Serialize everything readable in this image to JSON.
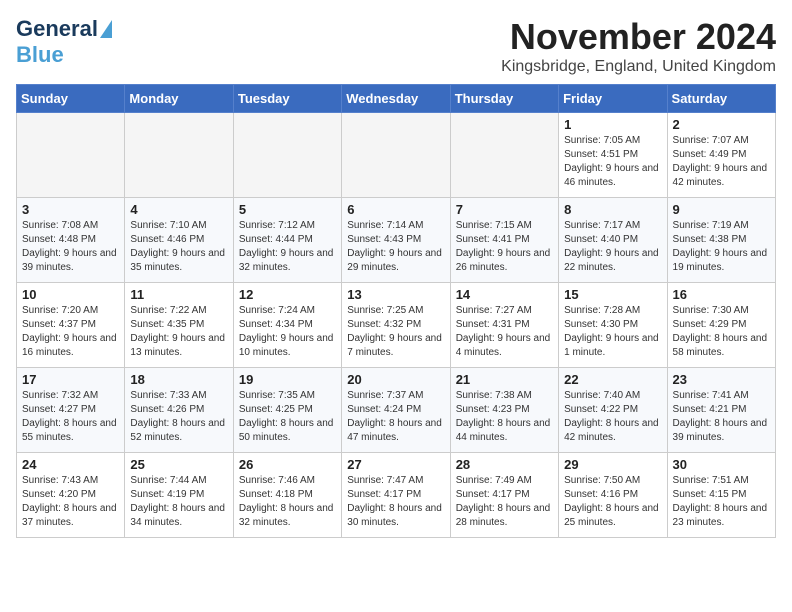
{
  "logo": {
    "text1": "General",
    "text2": "Blue"
  },
  "title": "November 2024",
  "location": "Kingsbridge, England, United Kingdom",
  "weekdays": [
    "Sunday",
    "Monday",
    "Tuesday",
    "Wednesday",
    "Thursday",
    "Friday",
    "Saturday"
  ],
  "weeks": [
    [
      {
        "day": "",
        "info": ""
      },
      {
        "day": "",
        "info": ""
      },
      {
        "day": "",
        "info": ""
      },
      {
        "day": "",
        "info": ""
      },
      {
        "day": "",
        "info": ""
      },
      {
        "day": "1",
        "info": "Sunrise: 7:05 AM\nSunset: 4:51 PM\nDaylight: 9 hours and 46 minutes."
      },
      {
        "day": "2",
        "info": "Sunrise: 7:07 AM\nSunset: 4:49 PM\nDaylight: 9 hours and 42 minutes."
      }
    ],
    [
      {
        "day": "3",
        "info": "Sunrise: 7:08 AM\nSunset: 4:48 PM\nDaylight: 9 hours and 39 minutes."
      },
      {
        "day": "4",
        "info": "Sunrise: 7:10 AM\nSunset: 4:46 PM\nDaylight: 9 hours and 35 minutes."
      },
      {
        "day": "5",
        "info": "Sunrise: 7:12 AM\nSunset: 4:44 PM\nDaylight: 9 hours and 32 minutes."
      },
      {
        "day": "6",
        "info": "Sunrise: 7:14 AM\nSunset: 4:43 PM\nDaylight: 9 hours and 29 minutes."
      },
      {
        "day": "7",
        "info": "Sunrise: 7:15 AM\nSunset: 4:41 PM\nDaylight: 9 hours and 26 minutes."
      },
      {
        "day": "8",
        "info": "Sunrise: 7:17 AM\nSunset: 4:40 PM\nDaylight: 9 hours and 22 minutes."
      },
      {
        "day": "9",
        "info": "Sunrise: 7:19 AM\nSunset: 4:38 PM\nDaylight: 9 hours and 19 minutes."
      }
    ],
    [
      {
        "day": "10",
        "info": "Sunrise: 7:20 AM\nSunset: 4:37 PM\nDaylight: 9 hours and 16 minutes."
      },
      {
        "day": "11",
        "info": "Sunrise: 7:22 AM\nSunset: 4:35 PM\nDaylight: 9 hours and 13 minutes."
      },
      {
        "day": "12",
        "info": "Sunrise: 7:24 AM\nSunset: 4:34 PM\nDaylight: 9 hours and 10 minutes."
      },
      {
        "day": "13",
        "info": "Sunrise: 7:25 AM\nSunset: 4:32 PM\nDaylight: 9 hours and 7 minutes."
      },
      {
        "day": "14",
        "info": "Sunrise: 7:27 AM\nSunset: 4:31 PM\nDaylight: 9 hours and 4 minutes."
      },
      {
        "day": "15",
        "info": "Sunrise: 7:28 AM\nSunset: 4:30 PM\nDaylight: 9 hours and 1 minute."
      },
      {
        "day": "16",
        "info": "Sunrise: 7:30 AM\nSunset: 4:29 PM\nDaylight: 8 hours and 58 minutes."
      }
    ],
    [
      {
        "day": "17",
        "info": "Sunrise: 7:32 AM\nSunset: 4:27 PM\nDaylight: 8 hours and 55 minutes."
      },
      {
        "day": "18",
        "info": "Sunrise: 7:33 AM\nSunset: 4:26 PM\nDaylight: 8 hours and 52 minutes."
      },
      {
        "day": "19",
        "info": "Sunrise: 7:35 AM\nSunset: 4:25 PM\nDaylight: 8 hours and 50 minutes."
      },
      {
        "day": "20",
        "info": "Sunrise: 7:37 AM\nSunset: 4:24 PM\nDaylight: 8 hours and 47 minutes."
      },
      {
        "day": "21",
        "info": "Sunrise: 7:38 AM\nSunset: 4:23 PM\nDaylight: 8 hours and 44 minutes."
      },
      {
        "day": "22",
        "info": "Sunrise: 7:40 AM\nSunset: 4:22 PM\nDaylight: 8 hours and 42 minutes."
      },
      {
        "day": "23",
        "info": "Sunrise: 7:41 AM\nSunset: 4:21 PM\nDaylight: 8 hours and 39 minutes."
      }
    ],
    [
      {
        "day": "24",
        "info": "Sunrise: 7:43 AM\nSunset: 4:20 PM\nDaylight: 8 hours and 37 minutes."
      },
      {
        "day": "25",
        "info": "Sunrise: 7:44 AM\nSunset: 4:19 PM\nDaylight: 8 hours and 34 minutes."
      },
      {
        "day": "26",
        "info": "Sunrise: 7:46 AM\nSunset: 4:18 PM\nDaylight: 8 hours and 32 minutes."
      },
      {
        "day": "27",
        "info": "Sunrise: 7:47 AM\nSunset: 4:17 PM\nDaylight: 8 hours and 30 minutes."
      },
      {
        "day": "28",
        "info": "Sunrise: 7:49 AM\nSunset: 4:17 PM\nDaylight: 8 hours and 28 minutes."
      },
      {
        "day": "29",
        "info": "Sunrise: 7:50 AM\nSunset: 4:16 PM\nDaylight: 8 hours and 25 minutes."
      },
      {
        "day": "30",
        "info": "Sunrise: 7:51 AM\nSunset: 4:15 PM\nDaylight: 8 hours and 23 minutes."
      }
    ]
  ]
}
